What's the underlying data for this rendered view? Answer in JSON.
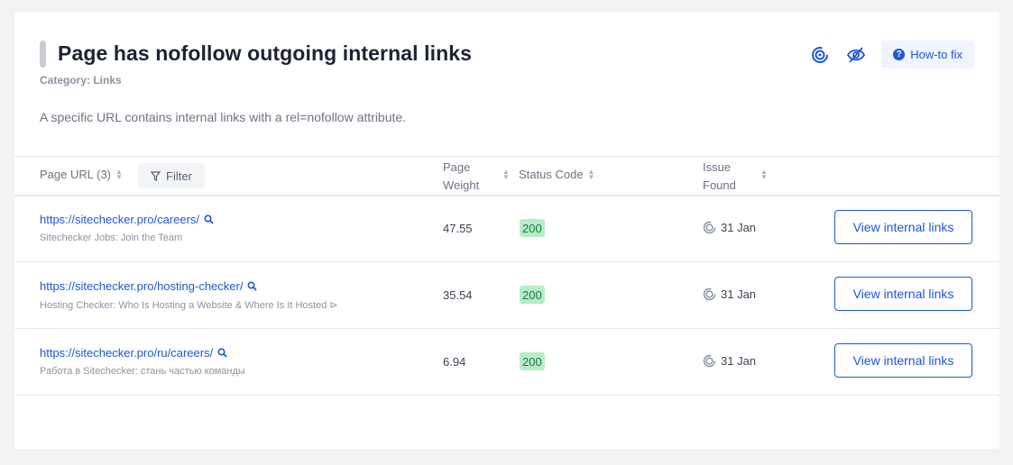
{
  "header": {
    "title": "Page has nofollow outgoing internal links",
    "category": "Category: Links",
    "description": "A specific URL contains internal links with a rel=nofollow attribute.",
    "howto_label": "How-to fix",
    "icons": [
      "history-icon",
      "hide-icon",
      "question-icon"
    ]
  },
  "table": {
    "col_url": "Page URL (3)",
    "filter_label": "Filter",
    "col_weight_1": "Page",
    "col_weight_2": "Weight",
    "col_status": "Status Code",
    "col_found_1": "Issue",
    "col_found_2": "Found",
    "rows": [
      {
        "url": "https://sitechecker.pro/careers/",
        "subtitle": "Sitechecker Jobs: Join the Team",
        "weight": "47.55",
        "status": "200",
        "found": "31 Jan",
        "action": "View internal links"
      },
      {
        "url": "https://sitechecker.pro/hosting-checker/",
        "subtitle": "Hosting Checker: Who Is Hosting a Website & Where Is It Hosted ⊳",
        "weight": "35.54",
        "status": "200",
        "found": "31 Jan",
        "action": "View internal links"
      },
      {
        "url": "https://sitechecker.pro/ru/careers/",
        "subtitle": "Работа в Sitechecker: стань частью команды",
        "weight": "6.94",
        "status": "200",
        "found": "31 Jan",
        "action": "View internal links"
      }
    ]
  },
  "colors": {
    "accent": "#1f56d6",
    "badge_bg": "#b7ecc8",
    "badge_text": "#1d7a3d"
  }
}
